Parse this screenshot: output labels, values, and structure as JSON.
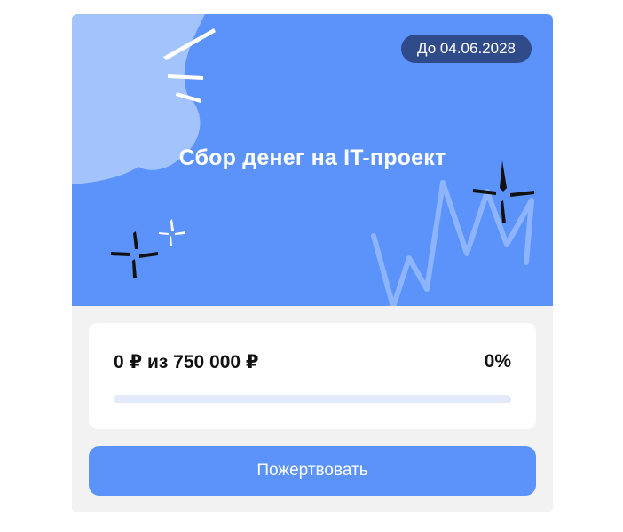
{
  "campaign": {
    "deadline_label": "До 04.06.2028",
    "title": "Сбор денег на IT-проект",
    "raised_text": "0 ₽ из 750 000 ₽",
    "percent_text": "0%",
    "progress": 0
  },
  "actions": {
    "donate_label": "Пожертвовать"
  },
  "colors": {
    "accent": "#5b93fb",
    "badge": "#2f4b8a",
    "track": "#e3ebfb"
  },
  "icons": {
    "banner_decor": [
      "cloud-shape",
      "sparkle-icon",
      "zigzag-line"
    ]
  }
}
